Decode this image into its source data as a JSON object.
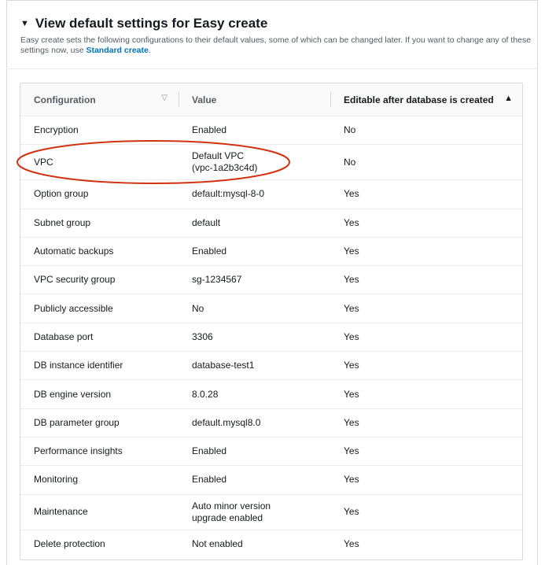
{
  "section": {
    "caret": "▼",
    "title": "View default settings for Easy create",
    "description": "Easy create sets the following configurations to their default values, some of which can be changed later. If you want to change any of these settings now, use ",
    "link_label": "Standard create",
    "description_end": "."
  },
  "table": {
    "columns": [
      {
        "label": "Configuration",
        "sort_icon": "▽"
      },
      {
        "label": "Value",
        "sort_icon": ""
      },
      {
        "label": "Editable after database is created",
        "sort_icon": "▲"
      }
    ],
    "rows": [
      {
        "config": "Encryption",
        "value": "Enabled",
        "editable": "No"
      },
      {
        "config": "VPC",
        "value": "Default VPC\n(vpc-1a2b3c4d)",
        "editable": "No"
      },
      {
        "config": "Option group",
        "value": "default:mysql-8-0",
        "editable": "Yes"
      },
      {
        "config": "Subnet group",
        "value": "default",
        "editable": "Yes"
      },
      {
        "config": "Automatic backups",
        "value": "Enabled",
        "editable": "Yes"
      },
      {
        "config": "VPC security group",
        "value": "sg-1234567",
        "editable": "Yes"
      },
      {
        "config": "Publicly accessible",
        "value": "No",
        "editable": "Yes"
      },
      {
        "config": "Database port",
        "value": "3306",
        "editable": "Yes"
      },
      {
        "config": "DB instance identifier",
        "value": "database-test1",
        "editable": "Yes"
      },
      {
        "config": "DB engine version",
        "value": "8.0.28",
        "editable": "Yes"
      },
      {
        "config": "DB parameter group",
        "value": "default.mysql8.0",
        "editable": "Yes"
      },
      {
        "config": "Performance insights",
        "value": "Enabled",
        "editable": "Yes"
      },
      {
        "config": "Monitoring",
        "value": "Enabled",
        "editable": "Yes"
      },
      {
        "config": "Maintenance",
        "value": "Auto minor version\nupgrade enabled",
        "editable": "Yes"
      },
      {
        "config": "Delete protection",
        "value": "Not enabled",
        "editable": "Yes"
      }
    ]
  },
  "highlight_color": "#d13212"
}
